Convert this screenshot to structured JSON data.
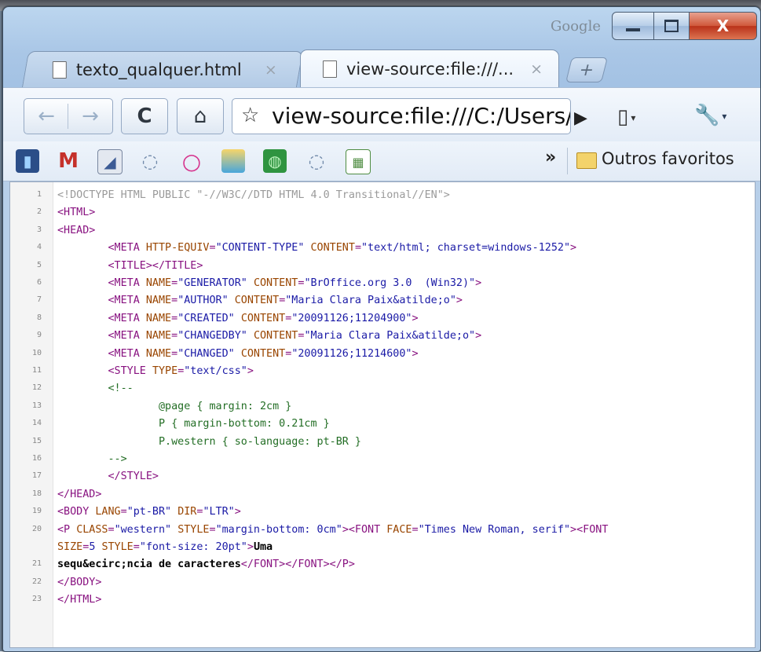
{
  "window": {
    "brand_label": "Google",
    "controls": {
      "minimize": "minimize",
      "maximize": "maximize",
      "close": "X"
    }
  },
  "tabs": [
    {
      "title": "texto_qualquer.html",
      "close": "×",
      "active": false
    },
    {
      "title": "view-source:file:///...",
      "close": "×",
      "active": true
    }
  ],
  "new_tab_label": "+",
  "toolbar": {
    "back": "←",
    "forward": "→",
    "reload": "C",
    "home": "⌂",
    "star": "☆",
    "url": "view-source:file:///C:/Users/",
    "go": "▶",
    "page_menu": "▯",
    "tools_menu": "🔧",
    "caret": "▾"
  },
  "bookmarks": {
    "items": [
      {
        "icon": "book-icon",
        "glyph": "▮"
      },
      {
        "icon": "gmail-icon",
        "glyph": "M"
      },
      {
        "icon": "rss-icon",
        "glyph": "◢"
      },
      {
        "icon": "chat-icon",
        "glyph": "◌"
      },
      {
        "icon": "orkut-icon",
        "glyph": "○"
      },
      {
        "icon": "msn-icon",
        "glyph": ""
      },
      {
        "icon": "globe-icon",
        "glyph": "◍"
      },
      {
        "icon": "chat-icon",
        "glyph": "◌"
      },
      {
        "icon": "table-icon",
        "glyph": "▦"
      }
    ],
    "overflow": "»",
    "other_label": "Outros favoritos"
  },
  "source": {
    "lines": [
      {
        "n": "1",
        "parts": [
          [
            "dt",
            "<!DOCTYPE HTML PUBLIC \"-//W3C//DTD HTML 4.0 Transitional//EN\">"
          ]
        ]
      },
      {
        "n": "2",
        "parts": [
          [
            "tag",
            "<HTML>"
          ]
        ]
      },
      {
        "n": "3",
        "parts": [
          [
            "tag",
            "<HEAD>"
          ]
        ]
      },
      {
        "n": "4",
        "parts": [
          [
            "tx",
            "\t"
          ],
          [
            "tag",
            "<META "
          ],
          [
            "at",
            "HTTP-EQUIV"
          ],
          [
            "tag",
            "="
          ],
          [
            "av",
            "\"CONTENT-TYPE\""
          ],
          [
            "tag",
            " "
          ],
          [
            "at",
            "CONTENT"
          ],
          [
            "tag",
            "="
          ],
          [
            "av",
            "\"text/html; charset=windows-1252\""
          ],
          [
            "tag",
            ">"
          ]
        ]
      },
      {
        "n": "5",
        "parts": [
          [
            "tx",
            "\t"
          ],
          [
            "tag",
            "<TITLE></TITLE>"
          ]
        ]
      },
      {
        "n": "6",
        "parts": [
          [
            "tx",
            "\t"
          ],
          [
            "tag",
            "<META "
          ],
          [
            "at",
            "NAME"
          ],
          [
            "tag",
            "="
          ],
          [
            "av",
            "\"GENERATOR\""
          ],
          [
            "tag",
            " "
          ],
          [
            "at",
            "CONTENT"
          ],
          [
            "tag",
            "="
          ],
          [
            "av",
            "\"BrOffice.org 3.0  (Win32)\""
          ],
          [
            "tag",
            ">"
          ]
        ]
      },
      {
        "n": "7",
        "parts": [
          [
            "tx",
            "\t"
          ],
          [
            "tag",
            "<META "
          ],
          [
            "at",
            "NAME"
          ],
          [
            "tag",
            "="
          ],
          [
            "av",
            "\"AUTHOR\""
          ],
          [
            "tag",
            " "
          ],
          [
            "at",
            "CONTENT"
          ],
          [
            "tag",
            "="
          ],
          [
            "av",
            "\"Maria Clara Paix&atilde;o\""
          ],
          [
            "tag",
            ">"
          ]
        ]
      },
      {
        "n": "8",
        "parts": [
          [
            "tx",
            "\t"
          ],
          [
            "tag",
            "<META "
          ],
          [
            "at",
            "NAME"
          ],
          [
            "tag",
            "="
          ],
          [
            "av",
            "\"CREATED\""
          ],
          [
            "tag",
            " "
          ],
          [
            "at",
            "CONTENT"
          ],
          [
            "tag",
            "="
          ],
          [
            "av",
            "\"20091126;11204900\""
          ],
          [
            "tag",
            ">"
          ]
        ]
      },
      {
        "n": "9",
        "parts": [
          [
            "tx",
            "\t"
          ],
          [
            "tag",
            "<META "
          ],
          [
            "at",
            "NAME"
          ],
          [
            "tag",
            "="
          ],
          [
            "av",
            "\"CHANGEDBY\""
          ],
          [
            "tag",
            " "
          ],
          [
            "at",
            "CONTENT"
          ],
          [
            "tag",
            "="
          ],
          [
            "av",
            "\"Maria Clara Paix&atilde;o\""
          ],
          [
            "tag",
            ">"
          ]
        ]
      },
      {
        "n": "10",
        "parts": [
          [
            "tx",
            "\t"
          ],
          [
            "tag",
            "<META "
          ],
          [
            "at",
            "NAME"
          ],
          [
            "tag",
            "="
          ],
          [
            "av",
            "\"CHANGED\""
          ],
          [
            "tag",
            " "
          ],
          [
            "at",
            "CONTENT"
          ],
          [
            "tag",
            "="
          ],
          [
            "av",
            "\"20091126;11214600\""
          ],
          [
            "tag",
            ">"
          ]
        ]
      },
      {
        "n": "11",
        "parts": [
          [
            "tx",
            "\t"
          ],
          [
            "tag",
            "<STYLE "
          ],
          [
            "at",
            "TYPE"
          ],
          [
            "tag",
            "="
          ],
          [
            "av",
            "\"text/css\""
          ],
          [
            "tag",
            ">"
          ]
        ]
      },
      {
        "n": "12",
        "parts": [
          [
            "tx",
            "\t"
          ],
          [
            "cm",
            "<!--"
          ]
        ]
      },
      {
        "n": "13",
        "parts": [
          [
            "tx",
            "\t\t"
          ],
          [
            "cm",
            "@page { margin: 2cm }"
          ]
        ]
      },
      {
        "n": "14",
        "parts": [
          [
            "tx",
            "\t\t"
          ],
          [
            "cm",
            "P { margin-bottom: 0.21cm }"
          ]
        ]
      },
      {
        "n": "15",
        "parts": [
          [
            "tx",
            "\t\t"
          ],
          [
            "cm",
            "P.western { so-language: pt-BR }"
          ]
        ]
      },
      {
        "n": "16",
        "parts": [
          [
            "tx",
            "\t"
          ],
          [
            "cm",
            "-->"
          ]
        ]
      },
      {
        "n": "17",
        "parts": [
          [
            "tx",
            "\t"
          ],
          [
            "tag",
            "</STYLE>"
          ]
        ]
      },
      {
        "n": "18",
        "parts": [
          [
            "tag",
            "</HEAD>"
          ]
        ]
      },
      {
        "n": "19",
        "parts": [
          [
            "tag",
            "<BODY "
          ],
          [
            "at",
            "LANG"
          ],
          [
            "tag",
            "="
          ],
          [
            "av",
            "\"pt-BR\""
          ],
          [
            "tag",
            " "
          ],
          [
            "at",
            "DIR"
          ],
          [
            "tag",
            "="
          ],
          [
            "av",
            "\"LTR\""
          ],
          [
            "tag",
            ">"
          ]
        ]
      },
      {
        "n": "20",
        "parts": [
          [
            "tag",
            "<P "
          ],
          [
            "at",
            "CLASS"
          ],
          [
            "tag",
            "="
          ],
          [
            "av",
            "\"western\""
          ],
          [
            "tag",
            " "
          ],
          [
            "at",
            "STYLE"
          ],
          [
            "tag",
            "="
          ],
          [
            "av",
            "\"margin-bottom: 0cm\""
          ],
          [
            "tag",
            "><FONT "
          ],
          [
            "at",
            "FACE"
          ],
          [
            "tag",
            "="
          ],
          [
            "av",
            "\"Times New Roman, serif\""
          ],
          [
            "tag",
            "><FONT"
          ]
        ]
      },
      {
        "n": "",
        "parts": [
          [
            "at",
            "SIZE"
          ],
          [
            "tag",
            "="
          ],
          [
            "av",
            "5"
          ],
          [
            "tag",
            " "
          ],
          [
            "at",
            "STYLE"
          ],
          [
            "tag",
            "="
          ],
          [
            "av",
            "\"font-size: 20pt\""
          ],
          [
            "tag",
            ">"
          ],
          [
            "tx",
            "Uma"
          ]
        ]
      },
      {
        "n": "21",
        "parts": [
          [
            "tx",
            "sequ&ecirc;ncia de caracteres"
          ],
          [
            "tag",
            "</FONT></FONT></P>"
          ]
        ]
      },
      {
        "n": "22",
        "parts": [
          [
            "tag",
            "</BODY>"
          ]
        ]
      },
      {
        "n": "23",
        "parts": [
          [
            "tag",
            "</HTML>"
          ]
        ]
      }
    ]
  }
}
